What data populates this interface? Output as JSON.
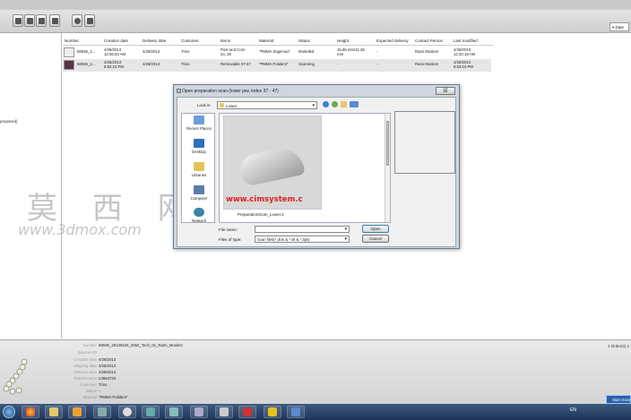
{
  "toolbar": {
    "sort_value": "▾ Date"
  },
  "sidebar": {
    "items": [
      "prepared)"
    ]
  },
  "table": {
    "columns": [
      "Number",
      "Creation date",
      "Delivery date",
      "Customer",
      "Items",
      "Material",
      "Status",
      "Height",
      "Expected delivery",
      "Contact Person",
      "Last modified"
    ],
    "rows": [
      {
        "number": "68036_2...",
        "creation": [
          "4/28/2013",
          "12:06:03 AM"
        ],
        "delivery": "4/28/2013",
        "customer": "Trios",
        "items": [
          "Post and Core",
          "24, 26"
        ],
        "material": "\"PMMA Sagemax\"",
        "status": "Modelled",
        "height": [
          "15.86 mm/11.36",
          "mm"
        ],
        "expected": "-",
        "contact": "Rami Moslem",
        "modified": [
          "4/28/2013",
          "12:32:18 AM"
        ]
      },
      {
        "number": "68036_2...",
        "creation": [
          "4/28/2013",
          "8:52:23 PM"
        ],
        "delivery": "4/28/2013",
        "customer": "Trios",
        "items": [
          "Removable 37-47",
          ""
        ],
        "material": "\"PMMA Polident\"",
        "status": "Scanning",
        "height": [
          "-",
          ""
        ],
        "expected": "-",
        "contact": "Rami Moslem",
        "modified": [
          "4/28/2013",
          "8:53:19 PM"
        ]
      }
    ]
  },
  "details": {
    "orders_count": "1 Order(s) s",
    "fields": [
      {
        "label": "Number",
        "value": "68036_20130426_2052_Tech_01_Rami_Moslem"
      },
      {
        "label": "Sources ID",
        "value": ""
      },
      {
        "label": "Creation date",
        "value": "4/28/2013"
      },
      {
        "label": "Shipping date",
        "value": "4/28/2013"
      },
      {
        "label": "Delivery date",
        "value": "4/28/2013"
      },
      {
        "label": "Patient name",
        "value": "L0663720"
      },
      {
        "label": "Customer",
        "value": "Trios"
      },
      {
        "label": "Status",
        "value": "-"
      },
      {
        "label": "Material",
        "value": "\"PMMA Polident\""
      }
    ]
  },
  "dialog": {
    "title": "Open preparation scan (lower jaw, index 37 - 47)",
    "close": "☒",
    "look_in_label": "Look in",
    "look_in_value": "Lower",
    "places": [
      "Recent Places",
      "Desktop",
      "Libraries",
      "Computer",
      "Network"
    ],
    "file_item": "PreparationScan_Lower.1",
    "thumbnail_watermark": "www.cimsystem.c",
    "file_name_label": "File name:",
    "file_name_value": "",
    "file_type_label": "Files of type:",
    "file_type_value": "Scan files(*.dcm & *.stl & *.3ps)",
    "open_label": "Open",
    "cancel_label": "Cancel"
  },
  "watermark": {
    "cn": "莫 西 网",
    "url": "www.3dmox.com"
  },
  "taskbar": {
    "lang": "EN",
    "clock": "",
    "notification": "Start Scan"
  }
}
